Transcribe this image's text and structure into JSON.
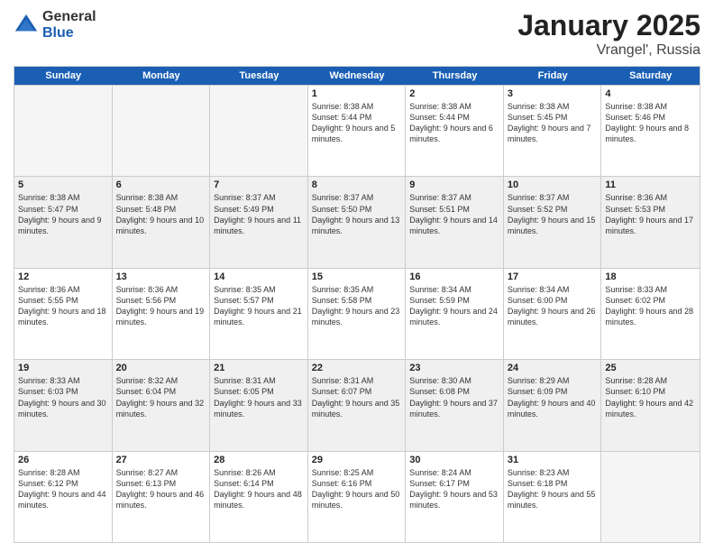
{
  "logo": {
    "general": "General",
    "blue": "Blue"
  },
  "header": {
    "month": "January 2025",
    "location": "Vrangel', Russia"
  },
  "days": [
    "Sunday",
    "Monday",
    "Tuesday",
    "Wednesday",
    "Thursday",
    "Friday",
    "Saturday"
  ],
  "weeks": [
    [
      {
        "day": "",
        "empty": true
      },
      {
        "day": "",
        "empty": true
      },
      {
        "day": "",
        "empty": true
      },
      {
        "day": "1",
        "sunrise": "Sunrise: 8:38 AM",
        "sunset": "Sunset: 5:44 PM",
        "daylight": "Daylight: 9 hours and 5 minutes."
      },
      {
        "day": "2",
        "sunrise": "Sunrise: 8:38 AM",
        "sunset": "Sunset: 5:44 PM",
        "daylight": "Daylight: 9 hours and 6 minutes."
      },
      {
        "day": "3",
        "sunrise": "Sunrise: 8:38 AM",
        "sunset": "Sunset: 5:45 PM",
        "daylight": "Daylight: 9 hours and 7 minutes."
      },
      {
        "day": "4",
        "sunrise": "Sunrise: 8:38 AM",
        "sunset": "Sunset: 5:46 PM",
        "daylight": "Daylight: 9 hours and 8 minutes."
      }
    ],
    [
      {
        "day": "5",
        "sunrise": "Sunrise: 8:38 AM",
        "sunset": "Sunset: 5:47 PM",
        "daylight": "Daylight: 9 hours and 9 minutes."
      },
      {
        "day": "6",
        "sunrise": "Sunrise: 8:38 AM",
        "sunset": "Sunset: 5:48 PM",
        "daylight": "Daylight: 9 hours and 10 minutes."
      },
      {
        "day": "7",
        "sunrise": "Sunrise: 8:37 AM",
        "sunset": "Sunset: 5:49 PM",
        "daylight": "Daylight: 9 hours and 11 minutes."
      },
      {
        "day": "8",
        "sunrise": "Sunrise: 8:37 AM",
        "sunset": "Sunset: 5:50 PM",
        "daylight": "Daylight: 9 hours and 13 minutes."
      },
      {
        "day": "9",
        "sunrise": "Sunrise: 8:37 AM",
        "sunset": "Sunset: 5:51 PM",
        "daylight": "Daylight: 9 hours and 14 minutes."
      },
      {
        "day": "10",
        "sunrise": "Sunrise: 8:37 AM",
        "sunset": "Sunset: 5:52 PM",
        "daylight": "Daylight: 9 hours and 15 minutes."
      },
      {
        "day": "11",
        "sunrise": "Sunrise: 8:36 AM",
        "sunset": "Sunset: 5:53 PM",
        "daylight": "Daylight: 9 hours and 17 minutes."
      }
    ],
    [
      {
        "day": "12",
        "sunrise": "Sunrise: 8:36 AM",
        "sunset": "Sunset: 5:55 PM",
        "daylight": "Daylight: 9 hours and 18 minutes."
      },
      {
        "day": "13",
        "sunrise": "Sunrise: 8:36 AM",
        "sunset": "Sunset: 5:56 PM",
        "daylight": "Daylight: 9 hours and 19 minutes."
      },
      {
        "day": "14",
        "sunrise": "Sunrise: 8:35 AM",
        "sunset": "Sunset: 5:57 PM",
        "daylight": "Daylight: 9 hours and 21 minutes."
      },
      {
        "day": "15",
        "sunrise": "Sunrise: 8:35 AM",
        "sunset": "Sunset: 5:58 PM",
        "daylight": "Daylight: 9 hours and 23 minutes."
      },
      {
        "day": "16",
        "sunrise": "Sunrise: 8:34 AM",
        "sunset": "Sunset: 5:59 PM",
        "daylight": "Daylight: 9 hours and 24 minutes."
      },
      {
        "day": "17",
        "sunrise": "Sunrise: 8:34 AM",
        "sunset": "Sunset: 6:00 PM",
        "daylight": "Daylight: 9 hours and 26 minutes."
      },
      {
        "day": "18",
        "sunrise": "Sunrise: 8:33 AM",
        "sunset": "Sunset: 6:02 PM",
        "daylight": "Daylight: 9 hours and 28 minutes."
      }
    ],
    [
      {
        "day": "19",
        "sunrise": "Sunrise: 8:33 AM",
        "sunset": "Sunset: 6:03 PM",
        "daylight": "Daylight: 9 hours and 30 minutes."
      },
      {
        "day": "20",
        "sunrise": "Sunrise: 8:32 AM",
        "sunset": "Sunset: 6:04 PM",
        "daylight": "Daylight: 9 hours and 32 minutes."
      },
      {
        "day": "21",
        "sunrise": "Sunrise: 8:31 AM",
        "sunset": "Sunset: 6:05 PM",
        "daylight": "Daylight: 9 hours and 33 minutes."
      },
      {
        "day": "22",
        "sunrise": "Sunrise: 8:31 AM",
        "sunset": "Sunset: 6:07 PM",
        "daylight": "Daylight: 9 hours and 35 minutes."
      },
      {
        "day": "23",
        "sunrise": "Sunrise: 8:30 AM",
        "sunset": "Sunset: 6:08 PM",
        "daylight": "Daylight: 9 hours and 37 minutes."
      },
      {
        "day": "24",
        "sunrise": "Sunrise: 8:29 AM",
        "sunset": "Sunset: 6:09 PM",
        "daylight": "Daylight: 9 hours and 40 minutes."
      },
      {
        "day": "25",
        "sunrise": "Sunrise: 8:28 AM",
        "sunset": "Sunset: 6:10 PM",
        "daylight": "Daylight: 9 hours and 42 minutes."
      }
    ],
    [
      {
        "day": "26",
        "sunrise": "Sunrise: 8:28 AM",
        "sunset": "Sunset: 6:12 PM",
        "daylight": "Daylight: 9 hours and 44 minutes."
      },
      {
        "day": "27",
        "sunrise": "Sunrise: 8:27 AM",
        "sunset": "Sunset: 6:13 PM",
        "daylight": "Daylight: 9 hours and 46 minutes."
      },
      {
        "day": "28",
        "sunrise": "Sunrise: 8:26 AM",
        "sunset": "Sunset: 6:14 PM",
        "daylight": "Daylight: 9 hours and 48 minutes."
      },
      {
        "day": "29",
        "sunrise": "Sunrise: 8:25 AM",
        "sunset": "Sunset: 6:16 PM",
        "daylight": "Daylight: 9 hours and 50 minutes."
      },
      {
        "day": "30",
        "sunrise": "Sunrise: 8:24 AM",
        "sunset": "Sunset: 6:17 PM",
        "daylight": "Daylight: 9 hours and 53 minutes."
      },
      {
        "day": "31",
        "sunrise": "Sunrise: 8:23 AM",
        "sunset": "Sunset: 6:18 PM",
        "daylight": "Daylight: 9 hours and 55 minutes."
      },
      {
        "day": "",
        "empty": true
      }
    ]
  ]
}
